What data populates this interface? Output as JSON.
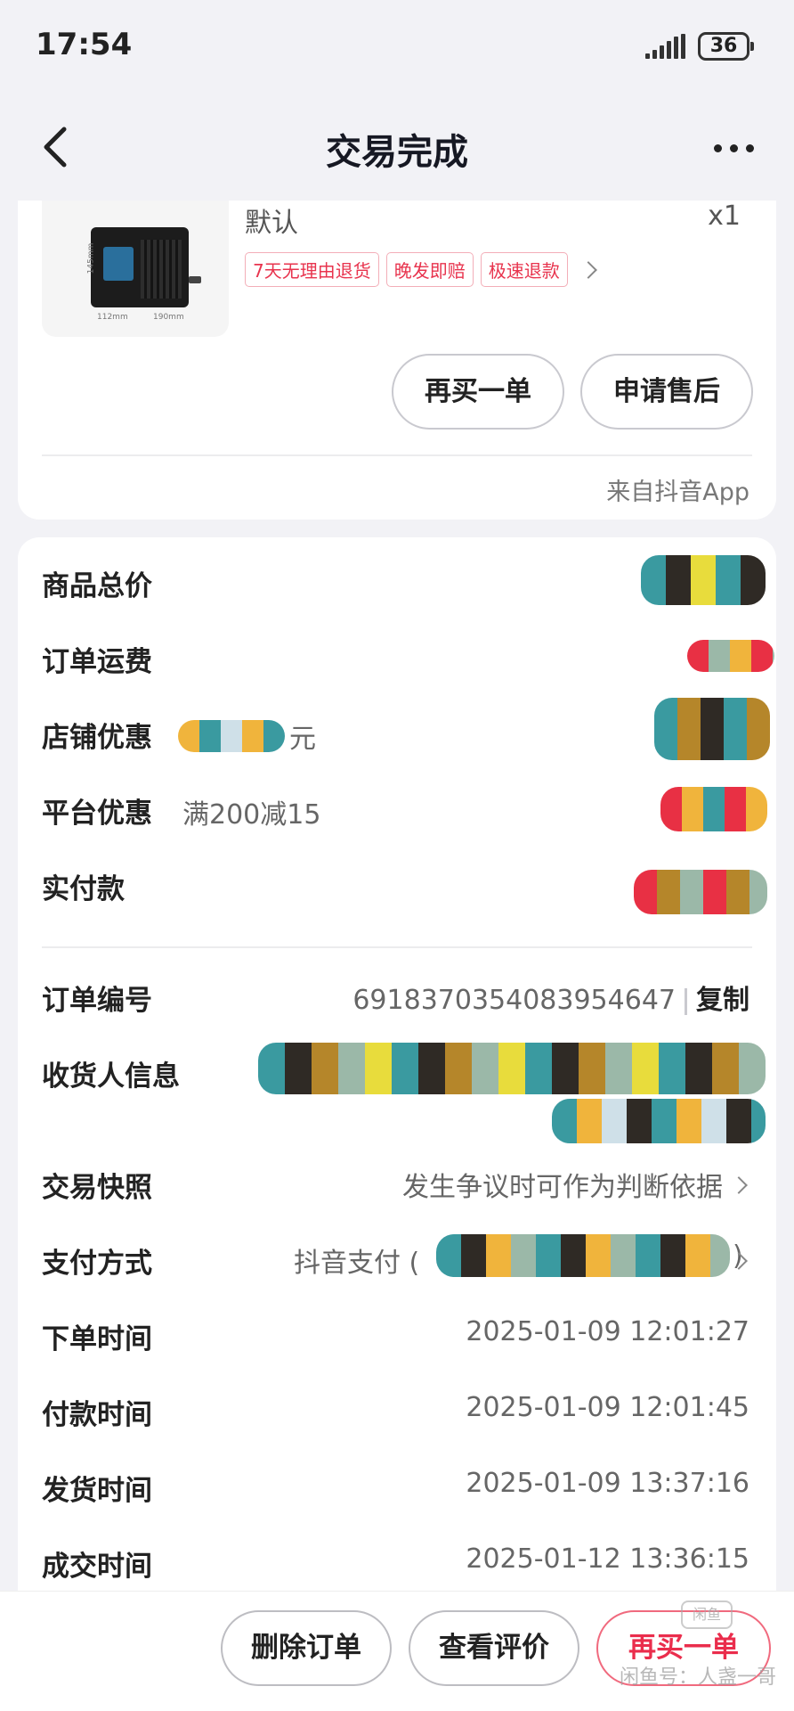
{
  "status_bar": {
    "time": "17:54",
    "battery": "36"
  },
  "nav": {
    "title": "交易完成"
  },
  "product": {
    "variant": "默认",
    "quantity": "x1",
    "tags": [
      "7天无理由退货",
      "晚发即赔",
      "极速退款"
    ],
    "dims": {
      "h": "145mm",
      "w": "112mm",
      "d": "190mm"
    },
    "buttons": {
      "buy_again": "再买一单",
      "after_sales": "申请售后"
    },
    "source": "来自抖音App"
  },
  "price": {
    "total_label": "商品总价",
    "shipping_label": "订单运费",
    "shop_discount_label": "店铺优惠",
    "shop_discount_sub_suffix": "元",
    "platform_discount_label": "平台优惠",
    "platform_discount_sub": "满200减15",
    "paid_label": "实付款"
  },
  "order": {
    "number_label": "订单编号",
    "number": "6918370354083954647",
    "copy": "复制",
    "receiver_label": "收货人信息",
    "snapshot_label": "交易快照",
    "snapshot_value": "发生争议时可作为判断依据",
    "payment_label": "支付方式",
    "payment_value_prefix": "抖音支付 (",
    "payment_value_suffix": ")",
    "times": [
      {
        "label": "下单时间",
        "value": "2025-01-09 12:01:27"
      },
      {
        "label": "付款时间",
        "value": "2025-01-09 12:01:45"
      },
      {
        "label": "发货时间",
        "value": "2025-01-09 13:37:16"
      },
      {
        "label": "成交时间",
        "value": "2025-01-12 13:36:15"
      }
    ]
  },
  "bottom": {
    "delete": "删除订单",
    "review": "查看评价",
    "buy_again": "再买一单",
    "watermark": "闲鱼号：人盏一哥",
    "wm_logo": "闲鱼"
  },
  "colors": {
    "accent_red": "#ea2d4c",
    "tag_border": "#f3aeb8",
    "background": "#f2f2f6"
  },
  "icons": [
    "back-arrow-icon",
    "more-dots-icon",
    "chevron-right-icon",
    "signal-icon",
    "battery-icon"
  ]
}
